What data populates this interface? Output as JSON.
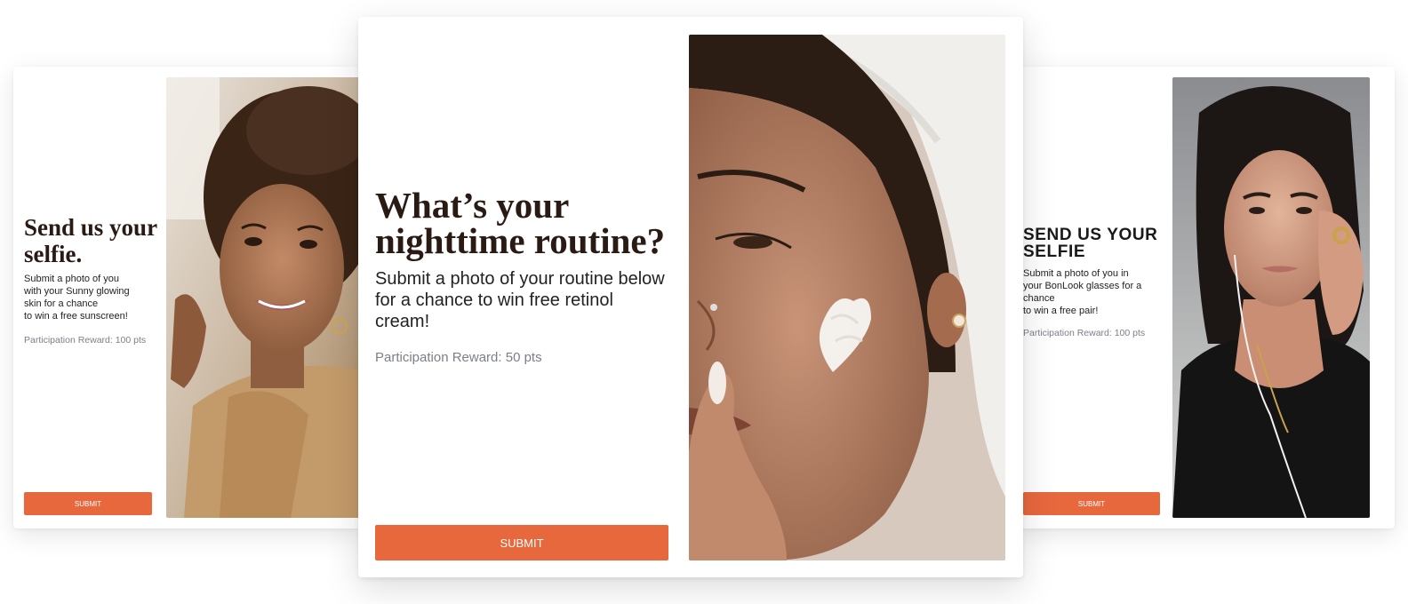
{
  "cards": {
    "left": {
      "title": "Send us your selfie.",
      "description": "Submit a photo of you\nwith your Sunny glowing\nskin for a chance\nto win a free sunscreen!",
      "reward": "Participation Reward: 100 pts",
      "submit_label": "SUBMIT",
      "photo_icon": "smiling-woman-curly-hair-photo"
    },
    "center": {
      "title": "What’s your nighttime routine?",
      "description": "Submit a photo of your routine below for a chance to win free retinol cream!",
      "reward": "Participation Reward: 50 pts",
      "submit_label": "SUBMIT",
      "photo_icon": "woman-towel-face-cream-photo"
    },
    "right": {
      "title": "SEND US YOUR SELFIE",
      "description": "Submit a photo of you in\nyour BonLook glasses for a\nchance\nto win a free pair!",
      "reward": "Participation Reward: 100 pts",
      "submit_label": "SUBMIT",
      "photo_icon": "woman-black-top-earphones-photo"
    }
  },
  "colors": {
    "accent": "#e8683e",
    "title": "#2a1a14",
    "reward": "#7b7f88"
  }
}
